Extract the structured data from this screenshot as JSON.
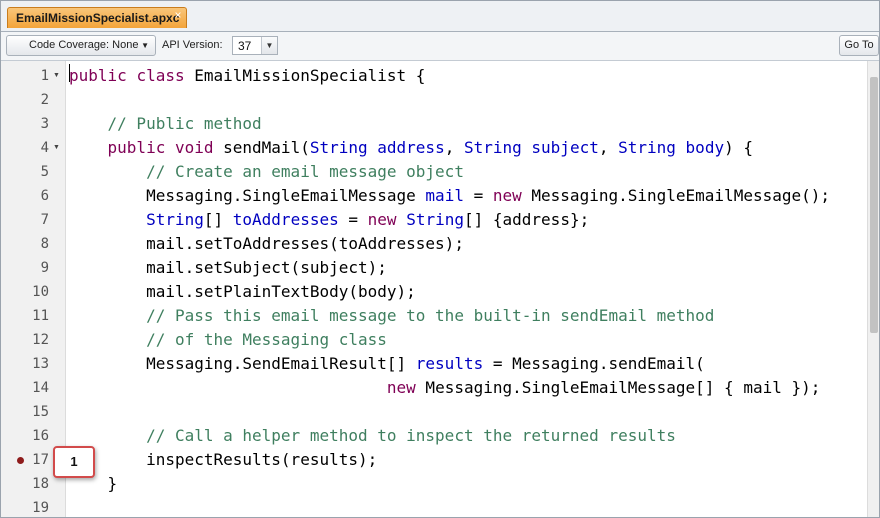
{
  "tab": {
    "file_name": "EmailMissionSpecialist.apxc",
    "close_glyph": "×"
  },
  "toolbar": {
    "coverage_label": "Code Coverage: None",
    "api_label": "API Version:",
    "api_version": "37",
    "goto_label": "Go To"
  },
  "editor": {
    "lines": [
      {
        "n": "1",
        "fold": true,
        "bp": false,
        "tokens": [
          {
            "t": "public",
            "c": "kw"
          },
          {
            "t": " "
          },
          {
            "t": "class",
            "c": "kw"
          },
          {
            "t": " EmailMissionSpecialist {"
          }
        ]
      },
      {
        "n": "2",
        "fold": false,
        "bp": false,
        "tokens": []
      },
      {
        "n": "3",
        "fold": false,
        "bp": false,
        "tokens": [
          {
            "t": "    "
          },
          {
            "t": "// Public method",
            "c": "cm"
          }
        ]
      },
      {
        "n": "4",
        "fold": true,
        "bp": false,
        "tokens": [
          {
            "t": "    "
          },
          {
            "t": "public",
            "c": "kw"
          },
          {
            "t": " "
          },
          {
            "t": "void",
            "c": "kw"
          },
          {
            "t": " sendMail("
          },
          {
            "t": "String",
            "c": "ty"
          },
          {
            "t": " "
          },
          {
            "t": "address",
            "c": "vr"
          },
          {
            "t": ", "
          },
          {
            "t": "String",
            "c": "ty"
          },
          {
            "t": " "
          },
          {
            "t": "subject",
            "c": "vr"
          },
          {
            "t": ", "
          },
          {
            "t": "String",
            "c": "ty"
          },
          {
            "t": " "
          },
          {
            "t": "body",
            "c": "vr"
          },
          {
            "t": ") {"
          }
        ]
      },
      {
        "n": "5",
        "fold": false,
        "bp": false,
        "tokens": [
          {
            "t": "        "
          },
          {
            "t": "// Create an email message object",
            "c": "cm"
          }
        ]
      },
      {
        "n": "6",
        "fold": false,
        "bp": false,
        "tokens": [
          {
            "t": "        Messaging.SingleEmailMessage "
          },
          {
            "t": "mail",
            "c": "vr"
          },
          {
            "t": " = "
          },
          {
            "t": "new",
            "c": "kw"
          },
          {
            "t": " Messaging.SingleEmailMessage();"
          }
        ]
      },
      {
        "n": "7",
        "fold": false,
        "bp": false,
        "tokens": [
          {
            "t": "        "
          },
          {
            "t": "String",
            "c": "ty"
          },
          {
            "t": "[] "
          },
          {
            "t": "toAddresses",
            "c": "vr"
          },
          {
            "t": " = "
          },
          {
            "t": "new",
            "c": "kw"
          },
          {
            "t": " "
          },
          {
            "t": "String",
            "c": "ty"
          },
          {
            "t": "[] {address};"
          }
        ]
      },
      {
        "n": "8",
        "fold": false,
        "bp": false,
        "tokens": [
          {
            "t": "        mail.setToAddresses(toAddresses);"
          }
        ]
      },
      {
        "n": "9",
        "fold": false,
        "bp": false,
        "tokens": [
          {
            "t": "        mail.setSubject(subject);"
          }
        ]
      },
      {
        "n": "10",
        "fold": false,
        "bp": false,
        "tokens": [
          {
            "t": "        mail.setPlainTextBody(body);"
          }
        ]
      },
      {
        "n": "11",
        "fold": false,
        "bp": false,
        "tokens": [
          {
            "t": "        "
          },
          {
            "t": "// Pass this email message to the built-in sendEmail method",
            "c": "cm"
          }
        ]
      },
      {
        "n": "12",
        "fold": false,
        "bp": false,
        "tokens": [
          {
            "t": "        "
          },
          {
            "t": "// of the Messaging class",
            "c": "cm"
          }
        ]
      },
      {
        "n": "13",
        "fold": false,
        "bp": false,
        "tokens": [
          {
            "t": "        Messaging.SendEmailResult[] "
          },
          {
            "t": "results",
            "c": "vr"
          },
          {
            "t": " = Messaging.sendEmail("
          }
        ]
      },
      {
        "n": "14",
        "fold": false,
        "bp": false,
        "tokens": [
          {
            "t": "                                 "
          },
          {
            "t": "new",
            "c": "kw"
          },
          {
            "t": " Messaging.SingleEmailMessage[] { mail });"
          }
        ]
      },
      {
        "n": "15",
        "fold": false,
        "bp": false,
        "tokens": []
      },
      {
        "n": "16",
        "fold": false,
        "bp": false,
        "tokens": [
          {
            "t": "        "
          },
          {
            "t": "// Call a helper method to inspect the returned results",
            "c": "cm"
          }
        ]
      },
      {
        "n": "17",
        "fold": false,
        "bp": true,
        "tokens": [
          {
            "t": "        inspectResults(results);"
          }
        ]
      },
      {
        "n": "18",
        "fold": false,
        "bp": false,
        "tokens": [
          {
            "t": "    }"
          }
        ]
      },
      {
        "n": "19",
        "fold": false,
        "bp": false,
        "tokens": []
      }
    ]
  },
  "callout": {
    "label": "1"
  },
  "colors": {
    "keyword": "#7f0055",
    "type": "#0000c0",
    "comment": "#3f7f5f",
    "tab": "#f3a43a",
    "breakpoint": "#8e1b1b",
    "callout_border": "#d24b4b"
  }
}
